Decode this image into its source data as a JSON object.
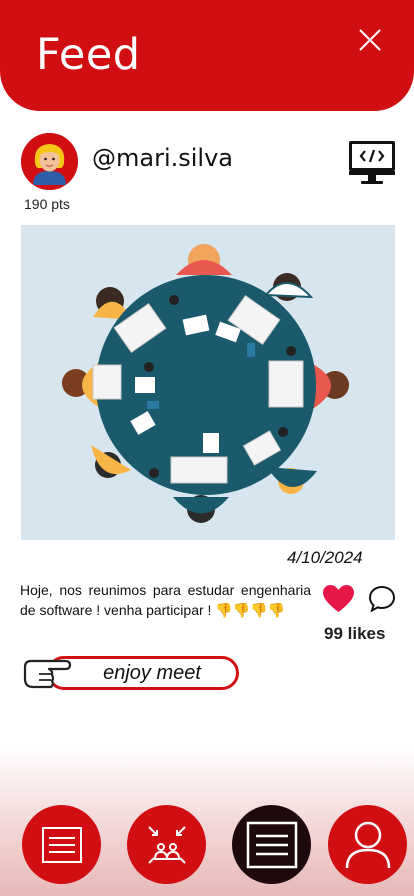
{
  "header": {
    "title": "Feed"
  },
  "post": {
    "username": "@mari.silva",
    "points": "190 pts",
    "date": "4/10/2024",
    "text": "Hoje, nos reunimos para estudar engenharia de software ! venha participar ! 👎👎👎👎",
    "likes": "99 likes",
    "tag": "enjoy meet"
  },
  "icons": {
    "close": "close-icon",
    "dev": "code-monitor-icon",
    "like": "heart-icon",
    "comment": "comment-icon",
    "hand": "pointing-hand-icon"
  },
  "nav": {
    "items": [
      "feed-list-icon",
      "team-network-icon",
      "document-list-icon",
      "profile-icon"
    ],
    "active_index": 2
  },
  "colors": {
    "brand": "#d10f13",
    "active_nav": "#1e0a0c",
    "like": "#e8174a"
  }
}
